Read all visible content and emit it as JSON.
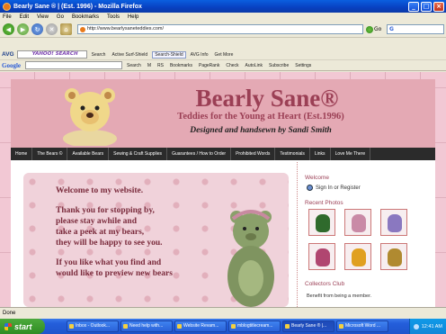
{
  "window": {
    "title": "Bearly Sane ® | (Est. 1996) - Mozilla Firefox"
  },
  "menu": [
    "File",
    "Edit",
    "View",
    "Go",
    "Bookmarks",
    "Tools",
    "Help"
  ],
  "address_bar": {
    "url": "http://www.bearlysaneteddies.com/",
    "go_label": "Go"
  },
  "avg_toolbar": {
    "logo": "AVG",
    "search_placeholder": "YAHOO! SEARCH",
    "search_label": "Search",
    "items": [
      "Active Surf-Shield",
      "Search-Shield",
      "AVG Info",
      "Get More"
    ]
  },
  "google_toolbar": {
    "logo": "Google",
    "items": [
      "Search",
      "M",
      "RS",
      "Bookmarks",
      "PageRank",
      "Check",
      "AutoLink",
      "Subscribe",
      "Settings"
    ]
  },
  "site": {
    "title": "Bearly Sane®",
    "subtitle": "Teddies for the Young at Heart (Est.1996)",
    "tagline": "Designed and handsewn by Sandi Smith",
    "nav": [
      "Home",
      "The Bears ©",
      "Available Bears",
      "Sewing & Craft Supplies",
      "Guarantees / How to Order",
      "Prohibited Words",
      "Testimonials",
      "Links",
      "Love Me There"
    ],
    "welcome": {
      "heading": "Welcome to my website.",
      "lines": [
        "Thank you for stopping by,",
        "please stay awhile and",
        "take a peek at my bears,",
        "they will be happy to see you.",
        "",
        "If you like what you find and",
        "would like to preview new bears"
      ]
    },
    "sidebar": {
      "welcome_heading": "Welcome",
      "signin": "Sign In or Register",
      "photos_heading": "Recent Photos",
      "thumb_colors": [
        "#2f6a2c",
        "#c98aa6",
        "#8a78c0",
        "#b04670",
        "#e0a020",
        "#b08a30"
      ],
      "collab_heading": "Collectors Club",
      "collab_text": "Benefit from being a member."
    }
  },
  "status": "Done",
  "taskbar": {
    "start": "start",
    "tasks": [
      "Inbox - Outlook...",
      "Need help with...",
      "Website Revam...",
      "mblogtitlecream...",
      "Bearly Sane ® |...",
      "Microsoft Word ..."
    ],
    "active_index": 4,
    "clock": "12:41 AM"
  }
}
